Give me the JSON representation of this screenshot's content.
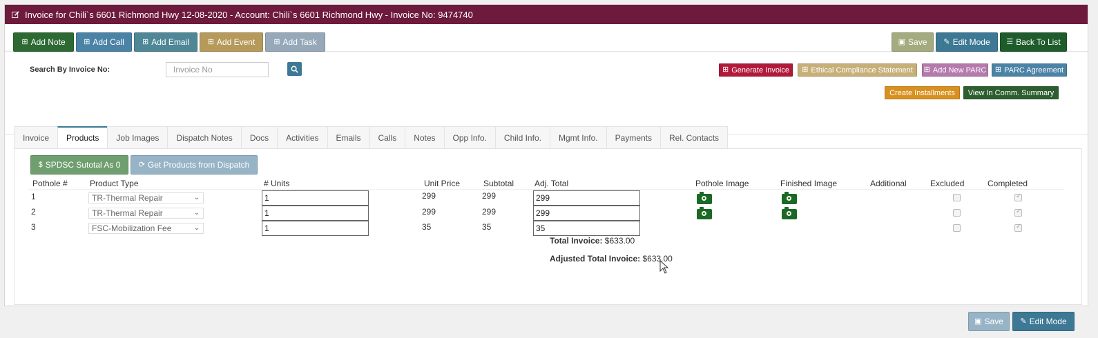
{
  "title": "Invoice for Chili`s 6601 Richmond Hwy 12-08-2020 - Account: Chili`s 6601 Richmond Hwy - Invoice No: 9474740",
  "toolbar": {
    "add_note": "Add Note",
    "add_call": "Add Call",
    "add_email": "Add Email",
    "add_event": "Add Event",
    "add_task": "Add Task",
    "save": "Save",
    "edit_mode": "Edit Mode",
    "back_to_list": "Back To List"
  },
  "actions": {
    "generate_invoice": "Generate Invoice",
    "ethical_compliance": "Ethical Compliance Statement",
    "add_new_parc": "Add New PARC",
    "parc_agreement": "PARC Agreement",
    "create_installments": "Create Installments",
    "view_comm_summary": "View In Comm. Summary"
  },
  "search": {
    "label": "Search By Invoice No:",
    "placeholder": "Invoice No"
  },
  "tabs": [
    {
      "label": "Invoice"
    },
    {
      "label": "Products"
    },
    {
      "label": "Job Images"
    },
    {
      "label": "Dispatch Notes"
    },
    {
      "label": "Docs"
    },
    {
      "label": "Activities"
    },
    {
      "label": "Emails"
    },
    {
      "label": "Calls"
    },
    {
      "label": "Notes"
    },
    {
      "label": "Opp Info."
    },
    {
      "label": "Child Info."
    },
    {
      "label": "Mgmt Info."
    },
    {
      "label": "Payments"
    },
    {
      "label": "Rel. Contacts"
    }
  ],
  "active_tab": "Products",
  "products": {
    "spdsc_button": "SPDSC Sutotal As 0",
    "get_products_button": "Get Products from Dispatch",
    "headers": {
      "pothole": "Pothole #",
      "product_type": "Product Type",
      "units": "# Units",
      "unit_price": "Unit Price",
      "subtotal": "Subtotal",
      "adj_total": "Adj. Total",
      "pothole_image": "Pothole Image",
      "finished_image": "Finished Image",
      "additional": "Additional",
      "excluded": "Excluded",
      "completed": "Completed"
    },
    "rows": [
      {
        "pothole": "1",
        "product_type": "TR-Thermal Repair",
        "units": "1",
        "unit_price": "299",
        "subtotal": "299",
        "adj_total": "299"
      },
      {
        "pothole": "2",
        "product_type": "TR-Thermal Repair",
        "units": "1",
        "unit_price": "299",
        "subtotal": "299",
        "adj_total": "299"
      },
      {
        "pothole": "3",
        "product_type": "FSC-Mobilization Fee",
        "units": "1",
        "unit_price": "35",
        "subtotal": "35",
        "adj_total": "35"
      }
    ],
    "total_invoice_label": "Total Invoice:",
    "total_invoice_value": "$633.00",
    "adjusted_total_label": "Adjusted Total Invoice:",
    "adjusted_total_value": "$633.00"
  },
  "footer": {
    "save": "Save",
    "edit_mode": "Edit Mode"
  },
  "colors": {
    "title_bar": "#6e1a3d",
    "add_note": "#2d6a33",
    "add_call": "#4b83a6",
    "add_email": "#4f8797",
    "add_event": "#b59a5b",
    "add_task": "#97a9b8",
    "save": "#a3ab7f",
    "edit_mode": "#3d7895",
    "back_to_list": "#1f5c2c",
    "generate_invoice": "#b1193a",
    "ethical": "#c7b078",
    "add_parc": "#b47aab",
    "parc_agreement": "#4b83a6",
    "installments": "#d8901f",
    "comm_summary": "#2d5e2f"
  }
}
